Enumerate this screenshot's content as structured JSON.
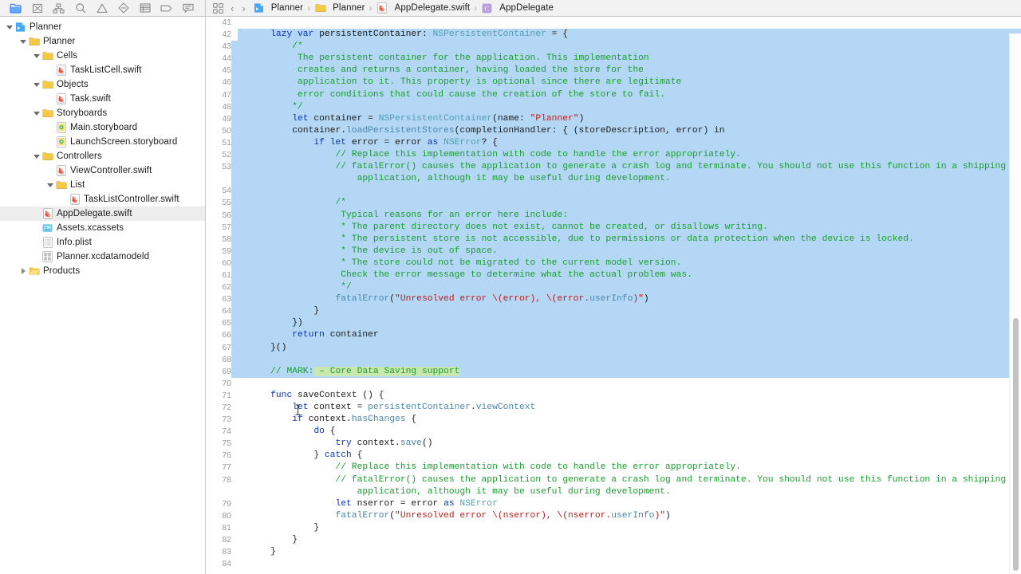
{
  "navigator": {
    "toolbar_icons": [
      {
        "name": "project-navigator-icon",
        "label": "Project navigator",
        "active": true
      },
      {
        "name": "source-control-navigator-icon",
        "label": "Source control navigator",
        "active": false
      },
      {
        "name": "symbol-navigator-icon",
        "label": "Symbol navigator",
        "active": false
      },
      {
        "name": "find-navigator-icon",
        "label": "Find navigator",
        "active": false
      },
      {
        "name": "issue-navigator-icon",
        "label": "Issue navigator",
        "active": false
      },
      {
        "name": "test-navigator-icon",
        "label": "Test navigator",
        "active": false
      },
      {
        "name": "debug-navigator-icon",
        "label": "Debug navigator",
        "active": false
      },
      {
        "name": "breakpoint-navigator-icon",
        "label": "Breakpoint navigator",
        "active": false
      },
      {
        "name": "report-navigator-icon",
        "label": "Report navigator",
        "active": false
      }
    ],
    "tree": [
      {
        "label": "Planner",
        "depth": 0,
        "icon": "xcode-project-icon",
        "twisty": "open",
        "selected": false
      },
      {
        "label": "Planner",
        "depth": 1,
        "icon": "folder-icon",
        "twisty": "open",
        "selected": false
      },
      {
        "label": "Cells",
        "depth": 2,
        "icon": "folder-icon",
        "twisty": "open",
        "selected": false
      },
      {
        "label": "TaskListCell.swift",
        "depth": 3,
        "icon": "swift-file-icon",
        "twisty": "none",
        "selected": false
      },
      {
        "label": "Objects",
        "depth": 2,
        "icon": "folder-icon",
        "twisty": "open",
        "selected": false
      },
      {
        "label": "Task.swift",
        "depth": 3,
        "icon": "swift-file-icon",
        "twisty": "none",
        "selected": false
      },
      {
        "label": "Storyboards",
        "depth": 2,
        "icon": "folder-icon",
        "twisty": "open",
        "selected": false
      },
      {
        "label": "Main.storyboard",
        "depth": 3,
        "icon": "storyboard-file-icon",
        "twisty": "none",
        "selected": false
      },
      {
        "label": "LaunchScreen.storyboard",
        "depth": 3,
        "icon": "storyboard-file-icon",
        "twisty": "none",
        "selected": false
      },
      {
        "label": "Controllers",
        "depth": 2,
        "icon": "folder-icon",
        "twisty": "open",
        "selected": false
      },
      {
        "label": "ViewController.swift",
        "depth": 3,
        "icon": "swift-file-icon",
        "twisty": "none",
        "selected": false
      },
      {
        "label": "List",
        "depth": 3,
        "icon": "folder-icon",
        "twisty": "open",
        "selected": false
      },
      {
        "label": "TaskListController.swift",
        "depth": 4,
        "icon": "swift-file-icon",
        "twisty": "none",
        "selected": false
      },
      {
        "label": "AppDelegate.swift",
        "depth": 2,
        "icon": "swift-file-icon",
        "twisty": "none",
        "selected": true
      },
      {
        "label": "Assets.xcassets",
        "depth": 2,
        "icon": "assets-file-icon",
        "twisty": "none",
        "selected": false
      },
      {
        "label": "Info.plist",
        "depth": 2,
        "icon": "plist-file-icon",
        "twisty": "none",
        "selected": false
      },
      {
        "label": "Planner.xcdatamodeld",
        "depth": 2,
        "icon": "datamodel-file-icon",
        "twisty": "none",
        "selected": false
      },
      {
        "label": "Products",
        "depth": 1,
        "icon": "products-folder-icon",
        "twisty": "closed",
        "selected": false
      }
    ]
  },
  "jumpbar": {
    "related_items_icon": "related-items-icon",
    "back_label": "‹",
    "forward_label": "›",
    "crumbs": [
      {
        "label": "Planner",
        "icon": "xcode-project-icon"
      },
      {
        "label": "Planner",
        "icon": "folder-icon"
      },
      {
        "label": "AppDelegate.swift",
        "icon": "swift-file-icon"
      },
      {
        "label": "AppDelegate",
        "icon": "class-symbol-icon"
      }
    ],
    "separator": "›"
  },
  "editor": {
    "selection_color": "#b3d7f4",
    "mark_highlight_color": "#c9e8b0",
    "first_line": 41,
    "last_line": 84,
    "lines": [
      {
        "n": 41,
        "sel": false,
        "sel_first": false,
        "tokens": []
      },
      {
        "n": 42,
        "sel": true,
        "sel_first": true,
        "tokens": [
          {
            "t": "    ",
            "c": "plain"
          },
          {
            "t": "lazy var ",
            "c": "kw"
          },
          {
            "t": "persistentContainer: ",
            "c": "plain"
          },
          {
            "t": "NSPersistentContainer",
            "c": "typ"
          },
          {
            "t": " = {",
            "c": "plain"
          }
        ]
      },
      {
        "n": 43,
        "sel": true,
        "tokens": [
          {
            "t": "        /*",
            "c": "cmt"
          }
        ]
      },
      {
        "n": 44,
        "sel": true,
        "tokens": [
          {
            "t": "         The persistent container for the application. This implementation",
            "c": "cmt"
          }
        ]
      },
      {
        "n": 45,
        "sel": true,
        "tokens": [
          {
            "t": "         creates and returns a container, having loaded the store for the",
            "c": "cmt"
          }
        ]
      },
      {
        "n": 46,
        "sel": true,
        "tokens": [
          {
            "t": "         application to it. This property is optional since there are legitimate",
            "c": "cmt"
          }
        ]
      },
      {
        "n": 47,
        "sel": true,
        "tokens": [
          {
            "t": "         error conditions that could cause the creation of the store to fail.",
            "c": "cmt"
          }
        ]
      },
      {
        "n": 48,
        "sel": true,
        "tokens": [
          {
            "t": "        */",
            "c": "cmt"
          }
        ]
      },
      {
        "n": 49,
        "sel": true,
        "tokens": [
          {
            "t": "        ",
            "c": "plain"
          },
          {
            "t": "let",
            "c": "kw"
          },
          {
            "t": " container = ",
            "c": "plain"
          },
          {
            "t": "NSPersistentContainer",
            "c": "typ"
          },
          {
            "t": "(name: ",
            "c": "plain"
          },
          {
            "t": "\"Planner\"",
            "c": "str"
          },
          {
            "t": ")",
            "c": "plain"
          }
        ]
      },
      {
        "n": 50,
        "sel": true,
        "tokens": [
          {
            "t": "        container.",
            "c": "plain"
          },
          {
            "t": "loadPersistentStores",
            "c": "fn"
          },
          {
            "t": "(completionHandler: { (storeDescription, error) in",
            "c": "plain"
          }
        ]
      },
      {
        "n": 51,
        "sel": true,
        "tokens": [
          {
            "t": "            ",
            "c": "plain"
          },
          {
            "t": "if let",
            "c": "kw"
          },
          {
            "t": " error = error ",
            "c": "plain"
          },
          {
            "t": "as",
            "c": "kw"
          },
          {
            "t": " ",
            "c": "plain"
          },
          {
            "t": "NSError",
            "c": "typ"
          },
          {
            "t": "? {",
            "c": "plain"
          }
        ]
      },
      {
        "n": 52,
        "sel": true,
        "tokens": [
          {
            "t": "                // Replace this implementation with code to handle the error appropriately.",
            "c": "cmt"
          }
        ]
      },
      {
        "n": 53,
        "sel": true,
        "wrap": true,
        "tokens": [
          {
            "t": "                // fatalError() causes the application to generate a crash log and terminate. You should not use this function in a shipping",
            "c": "cmt"
          }
        ],
        "wrap_text": "                    application, although it may be useful during development."
      },
      {
        "n": 54,
        "sel": true,
        "tokens": []
      },
      {
        "n": 55,
        "sel": true,
        "tokens": [
          {
            "t": "                /*",
            "c": "cmt"
          }
        ]
      },
      {
        "n": 56,
        "sel": true,
        "tokens": [
          {
            "t": "                 Typical reasons for an error here include:",
            "c": "cmt"
          }
        ]
      },
      {
        "n": 57,
        "sel": true,
        "tokens": [
          {
            "t": "                 * The parent directory does not exist, cannot be created, or disallows writing.",
            "c": "cmt"
          }
        ]
      },
      {
        "n": 58,
        "sel": true,
        "tokens": [
          {
            "t": "                 * The persistent store is not accessible, due to permissions or data protection when the device is locked.",
            "c": "cmt"
          }
        ]
      },
      {
        "n": 59,
        "sel": true,
        "tokens": [
          {
            "t": "                 * The device is out of space.",
            "c": "cmt"
          }
        ]
      },
      {
        "n": 60,
        "sel": true,
        "tokens": [
          {
            "t": "                 * The store could not be migrated to the current model version.",
            "c": "cmt"
          }
        ]
      },
      {
        "n": 61,
        "sel": true,
        "tokens": [
          {
            "t": "                 Check the error message to determine what the actual problem was.",
            "c": "cmt"
          }
        ]
      },
      {
        "n": 62,
        "sel": true,
        "tokens": [
          {
            "t": "                 */",
            "c": "cmt"
          }
        ]
      },
      {
        "n": 63,
        "sel": true,
        "tokens": [
          {
            "t": "                ",
            "c": "plain"
          },
          {
            "t": "fatalError",
            "c": "fn"
          },
          {
            "t": "(",
            "c": "plain"
          },
          {
            "t": "\"Unresolved error \\(error), \\(error.",
            "c": "str"
          },
          {
            "t": "userInfo",
            "c": "fn"
          },
          {
            "t": ")\"",
            "c": "str"
          },
          {
            "t": ")",
            "c": "plain"
          }
        ]
      },
      {
        "n": 64,
        "sel": true,
        "tokens": [
          {
            "t": "            }",
            "c": "plain"
          }
        ]
      },
      {
        "n": 65,
        "sel": true,
        "tokens": [
          {
            "t": "        })",
            "c": "plain"
          }
        ]
      },
      {
        "n": 66,
        "sel": true,
        "tokens": [
          {
            "t": "        ",
            "c": "plain"
          },
          {
            "t": "return",
            "c": "kw"
          },
          {
            "t": " container",
            "c": "plain"
          }
        ]
      },
      {
        "n": 67,
        "sel": true,
        "tokens": [
          {
            "t": "    }()",
            "c": "plain"
          }
        ]
      },
      {
        "n": 68,
        "sel": true,
        "tokens": []
      },
      {
        "n": 69,
        "sel": true,
        "tokens": [
          {
            "t": "    // MARK:",
            "c": "cmt"
          },
          {
            "t": " – Core Data Saving support",
            "c": "mk",
            "hi": true
          }
        ]
      },
      {
        "n": 70,
        "sel": false,
        "tokens": []
      },
      {
        "n": 71,
        "sel": false,
        "tokens": [
          {
            "t": "    ",
            "c": "plain"
          },
          {
            "t": "func",
            "c": "kw"
          },
          {
            "t": " saveContext () {",
            "c": "plain"
          }
        ]
      },
      {
        "n": 72,
        "sel": false,
        "tokens": [
          {
            "t": "        ",
            "c": "plain"
          },
          {
            "t": "let",
            "c": "kw"
          },
          {
            "t": " context = ",
            "c": "plain"
          },
          {
            "t": "persistentContainer",
            "c": "fn"
          },
          {
            "t": ".",
            "c": "plain"
          },
          {
            "t": "viewContext",
            "c": "fn"
          }
        ]
      },
      {
        "n": 73,
        "sel": false,
        "tokens": [
          {
            "t": "        ",
            "c": "plain"
          },
          {
            "t": "if",
            "c": "kw"
          },
          {
            "t": " context.",
            "c": "plain"
          },
          {
            "t": "hasChanges",
            "c": "fn"
          },
          {
            "t": " {",
            "c": "plain"
          }
        ]
      },
      {
        "n": 74,
        "sel": false,
        "tokens": [
          {
            "t": "            ",
            "c": "plain"
          },
          {
            "t": "do",
            "c": "kw"
          },
          {
            "t": " {",
            "c": "plain"
          }
        ]
      },
      {
        "n": 75,
        "sel": false,
        "tokens": [
          {
            "t": "                ",
            "c": "plain"
          },
          {
            "t": "try",
            "c": "kw"
          },
          {
            "t": " context.",
            "c": "plain"
          },
          {
            "t": "save",
            "c": "fn"
          },
          {
            "t": "()",
            "c": "plain"
          }
        ]
      },
      {
        "n": 76,
        "sel": false,
        "tokens": [
          {
            "t": "            } ",
            "c": "plain"
          },
          {
            "t": "catch",
            "c": "kw"
          },
          {
            "t": " {",
            "c": "plain"
          }
        ]
      },
      {
        "n": 77,
        "sel": false,
        "tokens": [
          {
            "t": "                // Replace this implementation with code to handle the error appropriately.",
            "c": "cmt"
          }
        ]
      },
      {
        "n": 78,
        "sel": false,
        "wrap": true,
        "tokens": [
          {
            "t": "                // fatalError() causes the application to generate a crash log and terminate. You should not use this function in a shipping",
            "c": "cmt"
          }
        ],
        "wrap_text": "                    application, although it may be useful during development."
      },
      {
        "n": 79,
        "sel": false,
        "tokens": [
          {
            "t": "                ",
            "c": "plain"
          },
          {
            "t": "let",
            "c": "kw"
          },
          {
            "t": " nserror = error ",
            "c": "plain"
          },
          {
            "t": "as",
            "c": "kw"
          },
          {
            "t": " ",
            "c": "plain"
          },
          {
            "t": "NSError",
            "c": "typ"
          }
        ]
      },
      {
        "n": 80,
        "sel": false,
        "tokens": [
          {
            "t": "                ",
            "c": "plain"
          },
          {
            "t": "fatalError",
            "c": "fn"
          },
          {
            "t": "(",
            "c": "plain"
          },
          {
            "t": "\"Unresolved error \\(nserror), \\(nserror.",
            "c": "str"
          },
          {
            "t": "userInfo",
            "c": "fn"
          },
          {
            "t": ")\"",
            "c": "str"
          },
          {
            "t": ")",
            "c": "plain"
          }
        ]
      },
      {
        "n": 81,
        "sel": false,
        "tokens": [
          {
            "t": "            }",
            "c": "plain"
          }
        ]
      },
      {
        "n": 82,
        "sel": false,
        "tokens": [
          {
            "t": "        }",
            "c": "plain"
          }
        ]
      },
      {
        "n": 83,
        "sel": false,
        "tokens": [
          {
            "t": "    }",
            "c": "plain"
          }
        ]
      },
      {
        "n": 84,
        "sel": false,
        "tokens": []
      }
    ]
  },
  "scrollbar": {
    "name": "vertical-scrollbar",
    "thumb_top_pct": 51
  }
}
